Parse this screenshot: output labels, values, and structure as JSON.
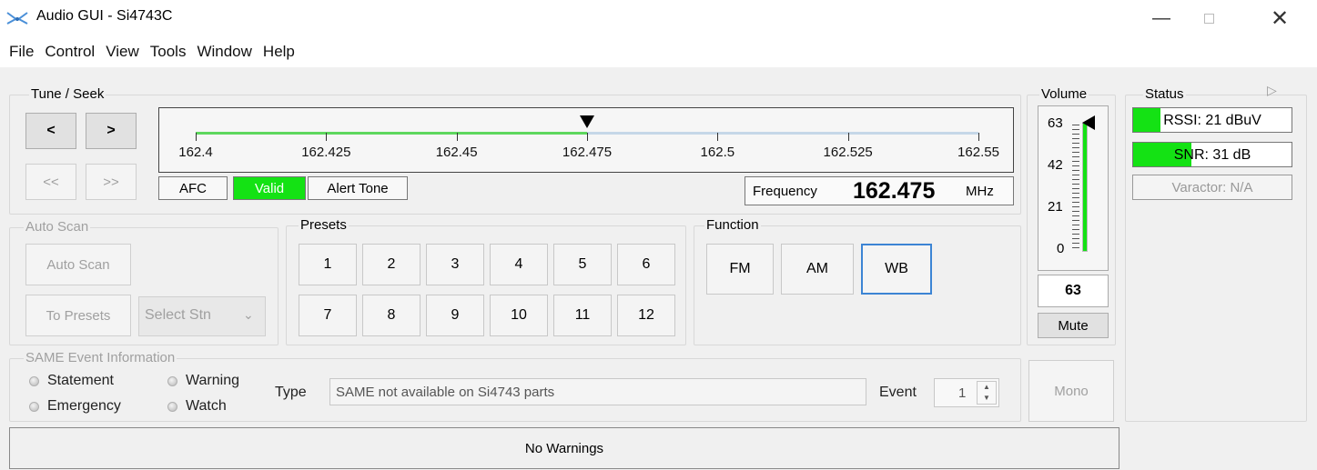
{
  "window": {
    "title": "Audio GUI - Si4743C"
  },
  "menu": [
    "File",
    "Control",
    "View",
    "Tools",
    "Window",
    "Help"
  ],
  "tune": {
    "group_label": "Tune / Seek",
    "prev_label": "<",
    "next_label": ">",
    "seek_prev_label": "<<",
    "seek_next_label": ">>",
    "scale_ticks": [
      "162.4",
      "162.425",
      "162.45",
      "162.475",
      "162.5",
      "162.525",
      "162.55"
    ],
    "tuned_fraction": 0.5,
    "afc_label": "AFC",
    "valid_label": "Valid",
    "alert_tone_label": "Alert Tone",
    "frequency_label": "Frequency",
    "frequency_value": "162.475",
    "frequency_unit": "MHz",
    "colors": {
      "valid_bg": "#14e214",
      "scale_fill": "#5ed75e",
      "scale_empty": "#c5d7e8"
    }
  },
  "auto_scan": {
    "group_label": "Auto Scan",
    "auto_scan_label": "Auto Scan",
    "to_presets_label": "To Presets",
    "select_station_value": "Select Stn"
  },
  "presets": {
    "group_label": "Presets",
    "buttons": [
      "1",
      "2",
      "3",
      "4",
      "5",
      "6",
      "7",
      "8",
      "9",
      "10",
      "11",
      "12"
    ]
  },
  "function": {
    "group_label": "Function",
    "buttons": [
      "FM",
      "AM",
      "WB"
    ],
    "selected": "WB"
  },
  "volume": {
    "group_label": "Volume",
    "scale_labels": [
      "63",
      "42",
      "21",
      "0"
    ],
    "value": "63",
    "level_fraction": 1.0,
    "mute_label": "Mute"
  },
  "mono_label": "Mono",
  "status": {
    "group_label": "Status",
    "rssi": {
      "text": "RSSI: 21 dBuV",
      "fill_fraction": 0.17
    },
    "snr": {
      "text": "SNR: 31 dB",
      "fill_fraction": 0.37
    },
    "varactor": {
      "text": "Varactor: N/A"
    },
    "colors": {
      "bar_fill": "#14e214"
    }
  },
  "same": {
    "group_label": "SAME Event Information",
    "statement_label": "Statement",
    "warning_label": "Warning",
    "emergency_label": "Emergency",
    "watch_label": "Watch",
    "type_label": "Type",
    "type_value": "SAME not available on Si4743 parts",
    "event_label": "Event",
    "event_value": "1"
  },
  "footer": {
    "warnings_text": "No Warnings"
  }
}
